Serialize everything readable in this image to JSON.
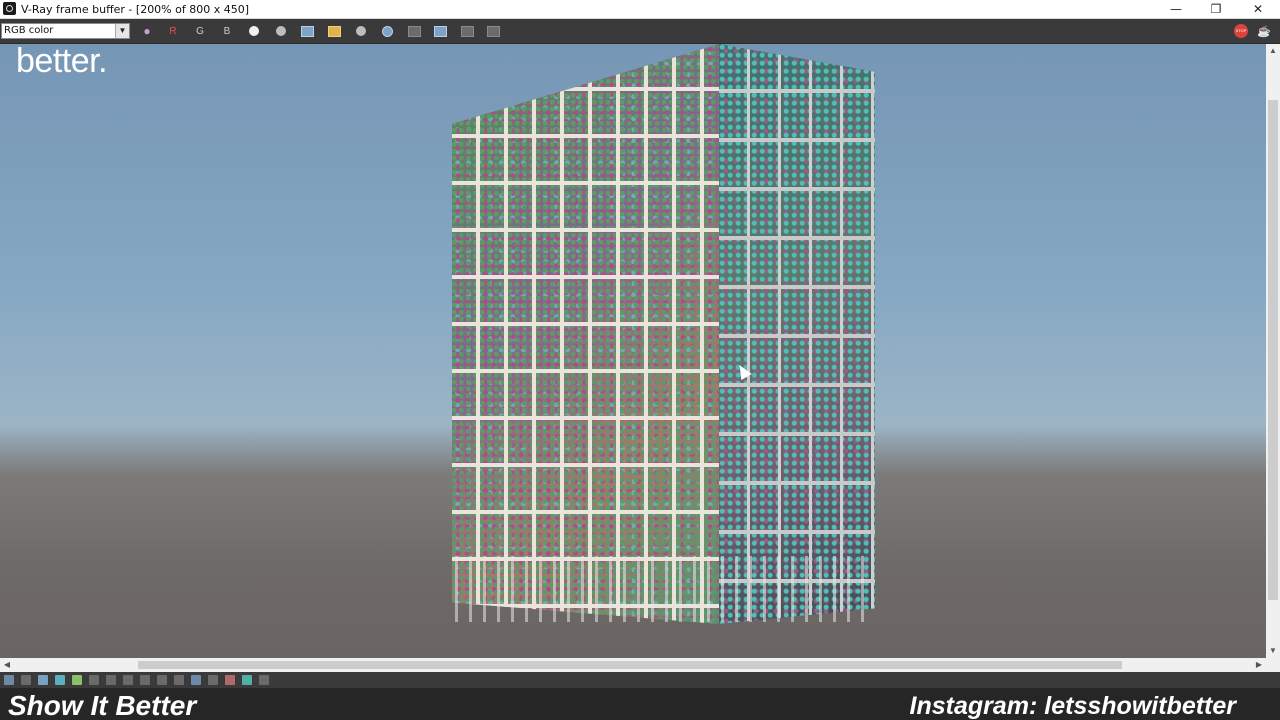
{
  "window": {
    "title": "V-Ray frame buffer - [200% of 800 x 450]",
    "controls": {
      "minimize": "—",
      "restore": "❐",
      "close": "✕"
    }
  },
  "toolbar": {
    "channel_value": "RGB color",
    "channel_arrow": "▼",
    "buttons": [
      {
        "name": "color-channels-icon",
        "label": "●"
      },
      {
        "name": "red-channel-button",
        "label": "R"
      },
      {
        "name": "green-channel-button",
        "label": "G"
      },
      {
        "name": "blue-channel-button",
        "label": "B"
      },
      {
        "name": "white-dot-icon",
        "label": ""
      },
      {
        "name": "mono-dot-icon",
        "label": ""
      },
      {
        "name": "save-image-icon",
        "label": ""
      },
      {
        "name": "load-image-icon",
        "label": ""
      },
      {
        "name": "clear-image-icon",
        "label": ""
      },
      {
        "name": "track-mouse-icon",
        "label": ""
      },
      {
        "name": "region-render-icon",
        "label": ""
      },
      {
        "name": "link-to-vfb-icon",
        "label": ""
      },
      {
        "name": "show-corrections-icon",
        "label": ""
      },
      {
        "name": "render-last-icon",
        "label": ""
      }
    ],
    "stop_label": "STOP",
    "teapot_icon": "☕"
  },
  "render": {
    "overlay_text": "better.",
    "colors": {
      "sky_top": "#7696b5",
      "horizon": "#9cb4c6",
      "ground": "#6a6563"
    }
  },
  "scroll": {
    "up": "▲",
    "down": "▼",
    "left": "◀",
    "right": "▶"
  },
  "watermark": {
    "brand": "Show It Better",
    "instagram": "Instagram: letsshowitbetter"
  }
}
